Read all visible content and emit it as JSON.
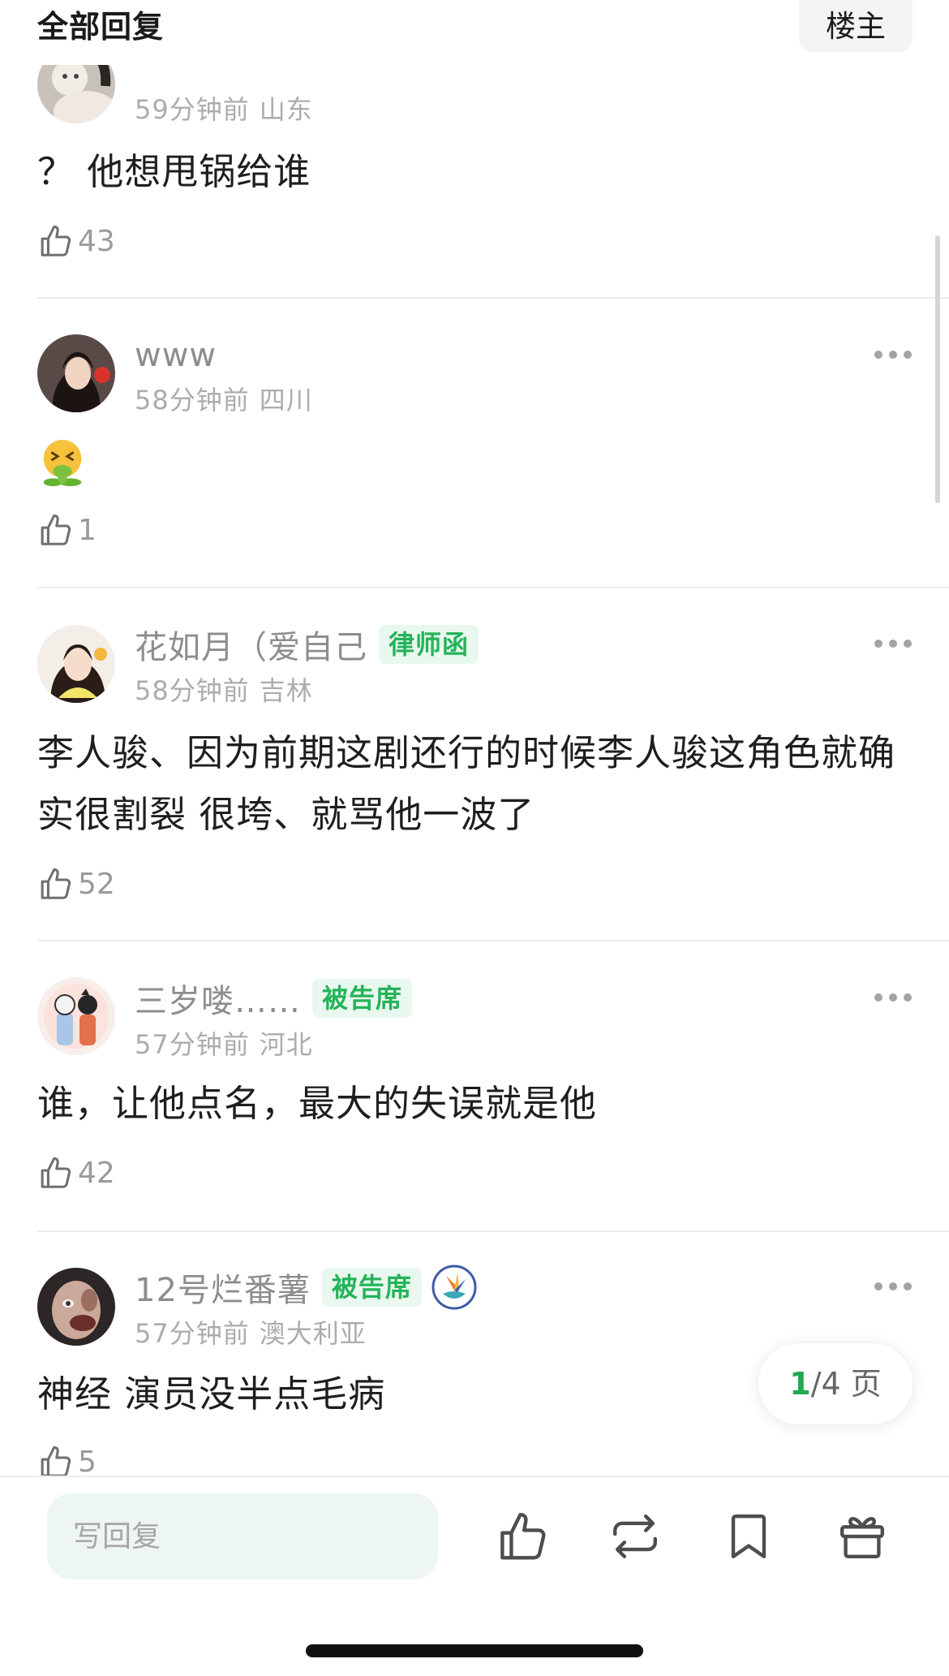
{
  "header": {
    "title": "全部回复",
    "owner_button": "楼主"
  },
  "comments": [
    {
      "time": "59分钟前",
      "location": "山东",
      "text": "？ 他想甩锅给谁",
      "likes": "43"
    },
    {
      "name": "www",
      "time": "58分钟前",
      "location": "四川",
      "emoji": "nauseated-face-emoji",
      "likes": "1"
    },
    {
      "name": "花如月（爱自己",
      "badge": "律师函",
      "time": "58分钟前",
      "location": "吉林",
      "text": "李人骏、因为前期这剧还行的时候李人骏这角色就确实很割裂 很垮、就骂他一波了",
      "likes": "52"
    },
    {
      "name": "三岁喽……",
      "badge": "被告席",
      "time": "57分钟前",
      "location": "河北",
      "text": "谁，让他点名，最大的失误就是他",
      "likes": "42"
    },
    {
      "name": "12号烂番薯",
      "badge": "被告席",
      "honor_icon": "bird-of-paradise-badge-icon",
      "time": "57分钟前",
      "location": "澳大利亚",
      "text": "神经 演员没半点毛病",
      "likes": "5"
    }
  ],
  "pager": {
    "current": "1",
    "total_label": "/4 页"
  },
  "bottom_bar": {
    "reply_placeholder": "写回复",
    "icons": [
      "thumbs-up-icon",
      "repost-icon",
      "bookmark-icon",
      "gift-icon"
    ]
  },
  "colors": {
    "accent_green": "#25b35a",
    "badge_bg": "#e9f8ee",
    "input_bg": "#eef6f1"
  }
}
